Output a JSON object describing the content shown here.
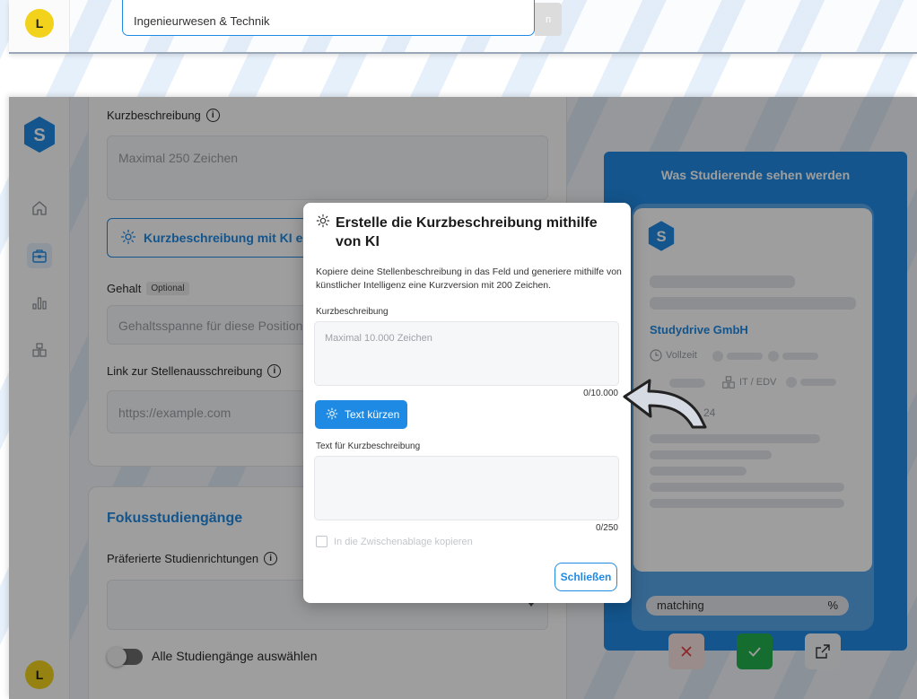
{
  "top_panel": {
    "avatar_initial": "L",
    "field_value": "Ingenieurwesen & Technik",
    "button_stub": "n"
  },
  "sidebar": {
    "logo_letter": "S",
    "items": [
      {
        "icon": "home-icon"
      },
      {
        "icon": "briefcase-icon",
        "active": true
      },
      {
        "icon": "bar-chart-icon"
      },
      {
        "icon": "company-icon"
      }
    ],
    "avatar_initial": "L"
  },
  "form": {
    "short_desc_label": "Kurzbeschreibung",
    "short_desc_placeholder": "Maximal 250 Zeichen",
    "ai_button_label": "Kurzbeschreibung mit KI erstellen",
    "salary_label": "Gehalt",
    "salary_chip": "Optional",
    "salary_placeholder": "Gehaltsspanne für diese Position",
    "link_label": "Link zur Stellenausschreibung",
    "link_placeholder": "https://example.com"
  },
  "focus": {
    "title": "Fokusstudiengänge",
    "preferred_label": "Präferierte Studienrichtungen",
    "toggle_label": "Alle Studiengänge auswählen"
  },
  "preview": {
    "title": "Was Studierende sehen werden",
    "logo_letter": "S",
    "company": "Studydrive GmbH",
    "employment": "Vollzeit",
    "category": "IT / EDV",
    "date_fragment": "24",
    "matching_label": "matching",
    "matching_unit": "%"
  },
  "modal": {
    "title": "Erstelle die Kurzbeschreibung mithilfe von KI",
    "description": "Kopiere deine Stellenbeschreibung in das Feld und generiere mithilfe von künstlicher Intelligenz eine Kurzversion mit 200 Zeichen.",
    "input_label": "Kurzbeschreibung",
    "input_placeholder": "Maximal 10.000 Zeichen",
    "input_counter": "0/10.000",
    "shorten_button": "Text kürzen",
    "output_label": "Text für Kurzbeschreibung",
    "output_counter": "0/250",
    "copy_label": "In die Zwischenablage kopieren",
    "close_button": "Schließen"
  },
  "colors": {
    "accent": "#1f8ae3",
    "avatar": "#f2d21b",
    "success": "#22b14c",
    "danger": "#e34242"
  }
}
